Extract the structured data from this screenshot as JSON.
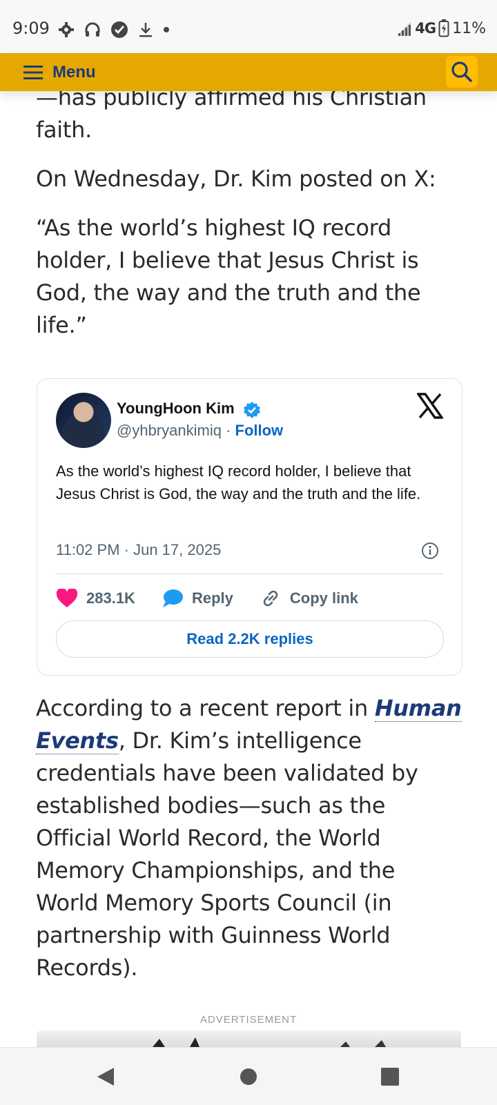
{
  "status_bar": {
    "time": "9:09",
    "network": "4G",
    "battery": "11%",
    "icons": [
      "settings-icon",
      "headphones-icon",
      "vpn-check-icon",
      "download-icon",
      "dot-icon",
      "signal-icon",
      "battery-charging-icon"
    ]
  },
  "header": {
    "menu_label": "Menu",
    "brand_color": "#e5a800",
    "search_icon": "search-icon"
  },
  "article": {
    "p1": "—has publicly affirmed his Christian faith.",
    "p2": "On Wednesday, Dr. Kim posted on X:",
    "p3": "“As the world’s highest IQ record holder, I believe that Jesus Christ is God, the way and the truth and the life.”",
    "p4_before": "According to a recent report in ",
    "p4_link": "Human Events",
    "p4_after": ", Dr. Kim’s intelligence credentials have been validated by established bodies—such as the Official World Record, the World Memory Championships, and the World Memory Sports Council (in partnership with Guinness World Records)."
  },
  "tweet": {
    "author": "YoungHoon Kim",
    "handle": "@yhbryankimiq",
    "separator": "·",
    "follow": "Follow",
    "text": "As the world’s highest IQ record holder, I believe that Jesus Christ is God, the way and the truth and the life.",
    "timestamp": "11:02 PM · Jun 17, 2025",
    "likes": "283.1K",
    "reply": "Reply",
    "copy_link": "Copy link",
    "read_replies": "Read 2.2K replies"
  },
  "ad": {
    "label": "ADVERTISEMENT"
  }
}
